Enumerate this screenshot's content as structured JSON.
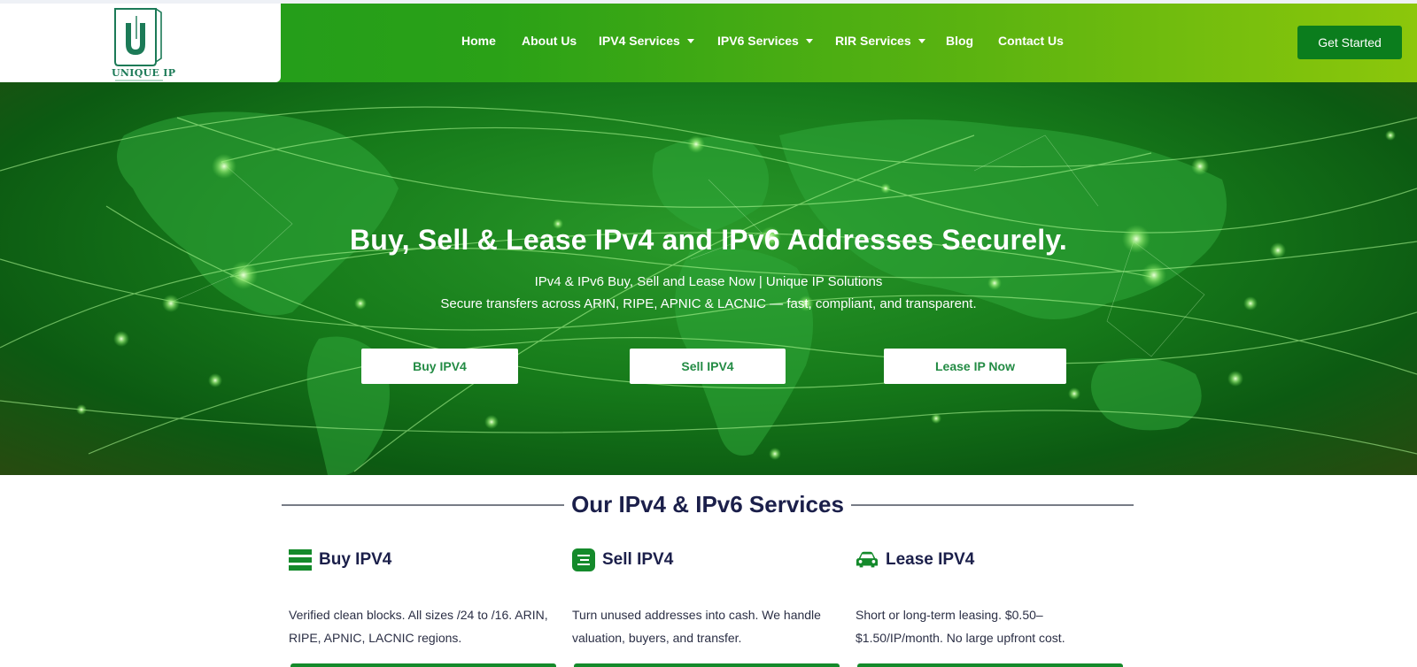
{
  "brand": {
    "name": "UNIQUE IP",
    "logo_icon": "u-cup-logo-icon"
  },
  "nav": {
    "items": [
      {
        "label": "Home",
        "dropdown": false
      },
      {
        "label": "About Us",
        "dropdown": false
      },
      {
        "label": "IPV4 Services",
        "dropdown": true
      },
      {
        "label": "IPV6 Services",
        "dropdown": true
      },
      {
        "label": "RIR Services",
        "dropdown": true
      },
      {
        "label": "Blog",
        "dropdown": false
      },
      {
        "label": "Contact Us",
        "dropdown": false
      }
    ],
    "cta_label": "Get Started"
  },
  "hero": {
    "title": "Buy, Sell & Lease IPv4 and IPv6 Addresses Securely.",
    "subtitle1": "IPv4 & IPv6 Buy, Sell and Lease Now | Unique IP Solutions",
    "subtitle2": "Secure transfers across ARIN, RIPE, APNIC & LACNIC — fast, compliant, and transparent.",
    "buttons": [
      "Buy IPV4",
      "Sell IPV4",
      "Lease IP Now"
    ]
  },
  "services": {
    "title": "Our IPv4 & IPv6 Services",
    "items": [
      {
        "name": "Buy IPV4",
        "icon": "stacked-bars-icon",
        "desc": "Verified clean blocks. All sizes /24 to /16. ARIN, RIPE, APNIC, LACNIC regions."
      },
      {
        "name": "Sell IPV4",
        "icon": "list-box-icon",
        "desc": "Turn unused addresses into cash. We handle valuation, buyers, and transfer."
      },
      {
        "name": "Lease IPV4",
        "icon": "car-icon",
        "desc": "Short or long-term leasing. $0.50–$1.50/IP/month. No large upfront cost."
      }
    ]
  },
  "colors": {
    "header_start": "#1e9a1e",
    "header_end": "#8cc70b",
    "cta_bg": "#0b7d1d",
    "accent_green": "#148a2b",
    "button_text": "#238b44",
    "heading": "#1b1f4a"
  }
}
